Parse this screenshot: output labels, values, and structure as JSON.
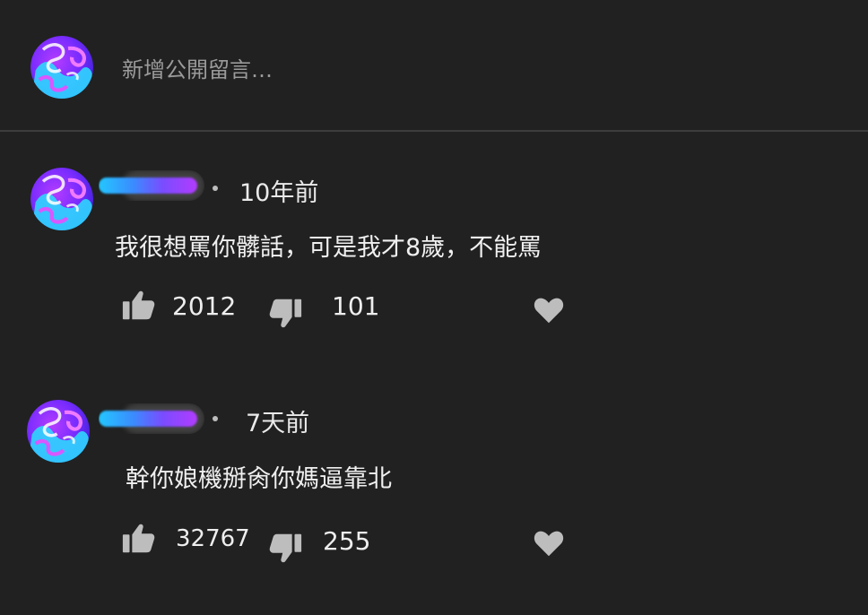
{
  "composer": {
    "placeholder": "新增公開留言…"
  },
  "comments": [
    {
      "time": "10年前",
      "text": "我很想罵你髒話，可是我才8歲，不能罵",
      "likes": "2012",
      "dislikes": "101"
    },
    {
      "time": "7天前",
      "text": "幹你娘機掰肏你媽逼靠北",
      "likes": "32767",
      "dislikes": "255"
    }
  ],
  "icons": {
    "like": "thumbs-up-icon",
    "dislike": "thumbs-down-icon",
    "heart": "heart-icon"
  },
  "colors": {
    "background": "#212121",
    "text": "#e8e8e8",
    "placeholder": "#9a9a9a",
    "icon": "#bdbdbd"
  }
}
